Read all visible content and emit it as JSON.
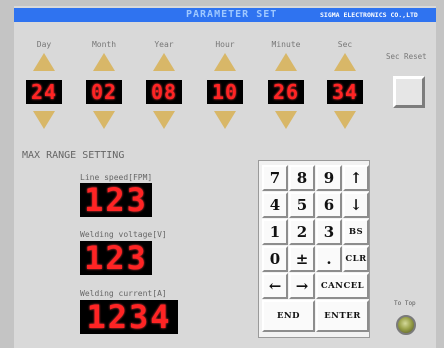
{
  "header": {
    "title": "PARAMETER SET",
    "company": "SIGMA ELECTRONICS CO.,LTD",
    "bar_color": "#2f73f0"
  },
  "datetime": {
    "columns": [
      {
        "label": "Day",
        "value": "24"
      },
      {
        "label": "Month",
        "value": "02"
      },
      {
        "label": "Year",
        "value": "08"
      },
      {
        "label": "Hour",
        "value": "10"
      },
      {
        "label": "Minute",
        "value": "26"
      },
      {
        "label": "Sec",
        "value": "34"
      }
    ],
    "sec_reset_label": "Sec Reset",
    "arrow_color": "#d8b768",
    "led_color": "#ff2424"
  },
  "max_range": {
    "title": "MAX RANGE SETTING",
    "line_speed": {
      "label": "Line speed[FPM]",
      "value": "123"
    },
    "welding_voltage": {
      "label": "Welding voltage[V]",
      "value": "123"
    },
    "welding_current": {
      "label": "Welding current[A]",
      "value": "1234"
    }
  },
  "keypad": {
    "keys": [
      "7",
      "8",
      "9",
      "↑",
      "4",
      "5",
      "6",
      "↓",
      "1",
      "2",
      "3",
      "BS",
      "0",
      "±",
      ".",
      "CLR",
      "←",
      "→",
      "CANCEL",
      "END",
      "ENTER"
    ]
  },
  "to_top": {
    "label": "To Top"
  }
}
